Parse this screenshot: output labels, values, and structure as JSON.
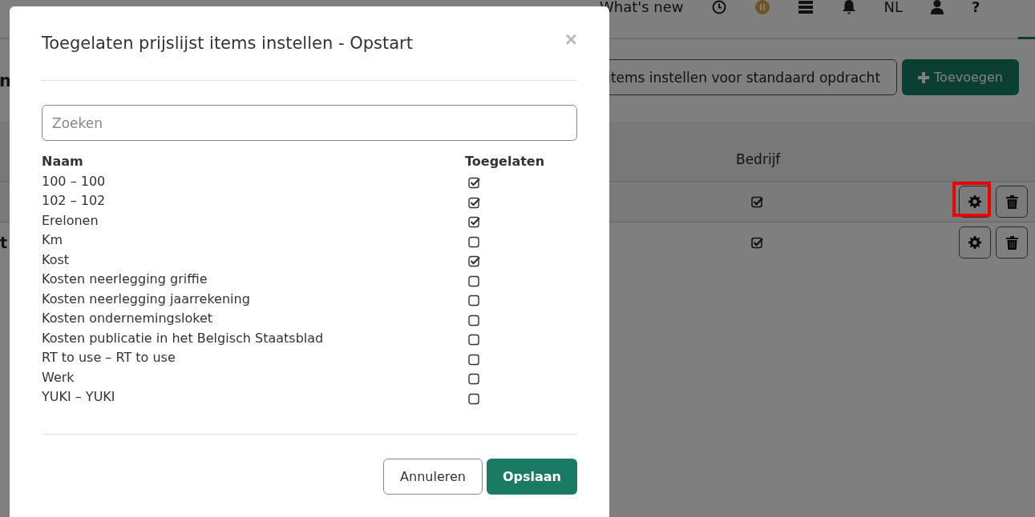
{
  "nav": {
    "whats_new": "What's new",
    "language": "NL",
    "help": "?",
    "indicator": true
  },
  "page": {
    "heading": "n",
    "actions": [
      {
        "label": "items instellen voor standaard opdracht",
        "kind": "outline"
      },
      {
        "label": "Toevoegen",
        "kind": "primary"
      }
    ],
    "table": {
      "column": "Bedrijf",
      "rows": [
        {
          "bedrijf": true,
          "highlighted": true
        },
        {
          "name": "t",
          "bedrijf": true,
          "highlighted": false
        }
      ]
    }
  },
  "modal": {
    "title": "Toegelaten prijslijst items instellen - Opstart",
    "close": "×",
    "search": {
      "placeholder": "Zoeken"
    },
    "columns": [
      "Naam",
      "Toegelaten"
    ],
    "items": [
      {
        "name": "100 – 100",
        "checked": true
      },
      {
        "name": "102 – 102",
        "checked": true
      },
      {
        "name": "Erelonen",
        "checked": true
      },
      {
        "name": "Km",
        "checked": false
      },
      {
        "name": "Kost",
        "checked": true
      },
      {
        "name": "Kosten neerlegging griffie",
        "checked": false
      },
      {
        "name": "Kosten neerlegging jaarrekening",
        "checked": false
      },
      {
        "name": "Kosten ondernemingsloket",
        "checked": false
      },
      {
        "name": "Kosten publicatie in het Belgisch Staatsblad",
        "checked": false
      },
      {
        "name": "RT to use – RT to use",
        "checked": false
      },
      {
        "name": "Werk",
        "checked": false
      },
      {
        "name": "YUKI – YUKI",
        "checked": false
      }
    ],
    "buttons": [
      {
        "label": "Annuleren",
        "kind": "secondary"
      },
      {
        "label": "Opslaan",
        "kind": "primary"
      }
    ]
  }
}
